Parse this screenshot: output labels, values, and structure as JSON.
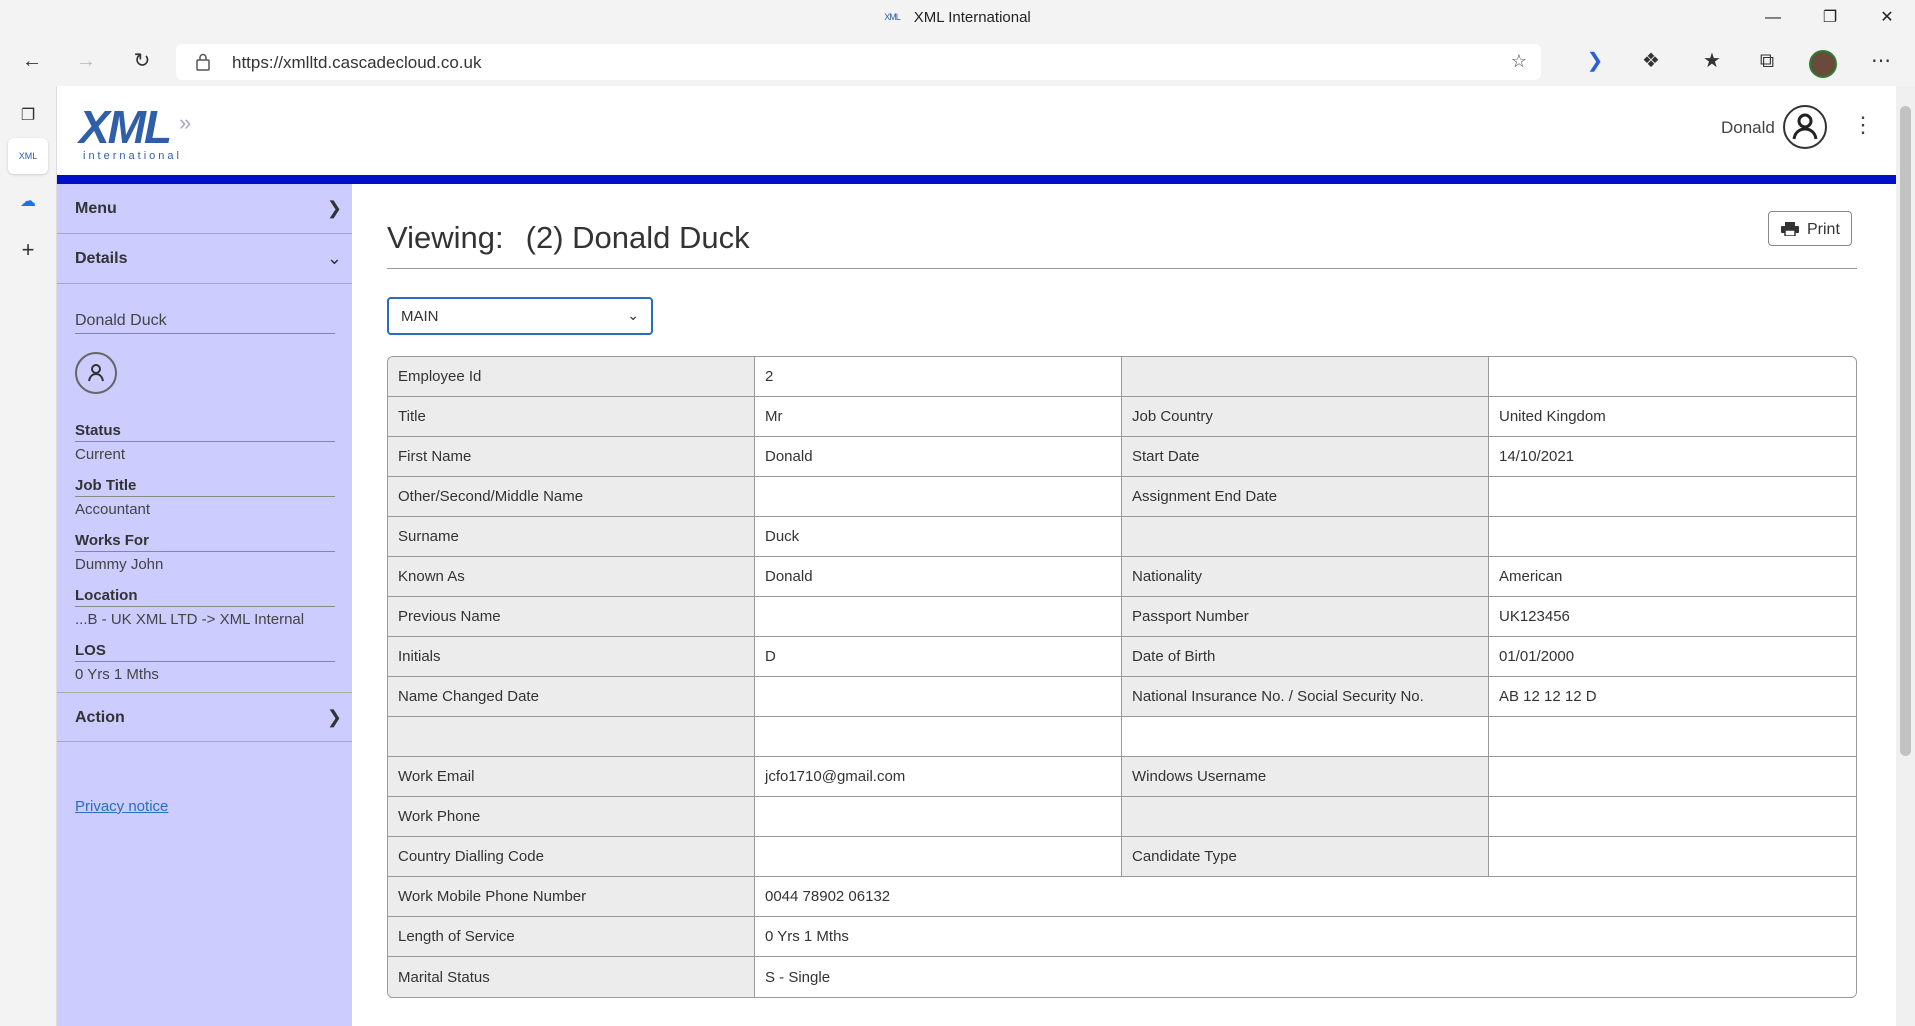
{
  "browser": {
    "tab_title": "XML International",
    "favicon_text": "XML",
    "url": "https://xmlltd.cascadecloud.co.uk"
  },
  "header": {
    "logo_main": "XML",
    "logo_sub": "international",
    "user_name": "Donald"
  },
  "sidebar": {
    "menu_label": "Menu",
    "details_label": "Details",
    "person_name": "Donald Duck",
    "sections": [
      {
        "key": "Status",
        "value": "Current"
      },
      {
        "key": "Job Title",
        "value": "Accountant"
      },
      {
        "key": "Works For",
        "value": "Dummy John"
      },
      {
        "key": "Location",
        "value": "...B - UK XML LTD -> XML Internal"
      },
      {
        "key": "LOS",
        "value": "0 Yrs 1 Mths"
      }
    ],
    "action_label": "Action",
    "privacy_label": "Privacy notice"
  },
  "main": {
    "viewing_prefix": "Viewing:",
    "viewing_name": "(2) Donald Duck",
    "print_label": "Print",
    "view_select_value": "MAIN"
  },
  "details": [
    [
      "Employee Id",
      "2",
      "",
      ""
    ],
    [
      "Title",
      "Mr",
      "Job Country",
      "United Kingdom"
    ],
    [
      "First Name",
      "Donald",
      "Start Date",
      "14/10/2021"
    ],
    [
      "Other/Second/Middle Name",
      "",
      "Assignment End Date",
      ""
    ],
    [
      "Surname",
      "Duck",
      "",
      ""
    ],
    [
      "Known As",
      "Donald",
      "Nationality",
      "American"
    ],
    [
      "Previous Name",
      "",
      "Passport Number",
      "UK123456"
    ],
    [
      "Initials",
      "D",
      "Date of Birth",
      "01/01/2000"
    ],
    [
      "Name Changed Date",
      "",
      "National Insurance No. / Social Security No.",
      "AB 12 12 12 D"
    ],
    [
      "",
      "",
      "",
      ""
    ],
    [
      "Work Email",
      "jcfo1710@gmail.com",
      "Windows Username",
      ""
    ],
    [
      "Work Phone",
      "",
      "",
      ""
    ],
    [
      "Country Dialling Code",
      "",
      "Candidate Type",
      ""
    ],
    [
      "Work Mobile Phone Number",
      "0044 78902 06132"
    ],
    [
      "Length of Service",
      "0 Yrs 1 Mths"
    ],
    [
      "Marital Status",
      "S - Single"
    ]
  ]
}
